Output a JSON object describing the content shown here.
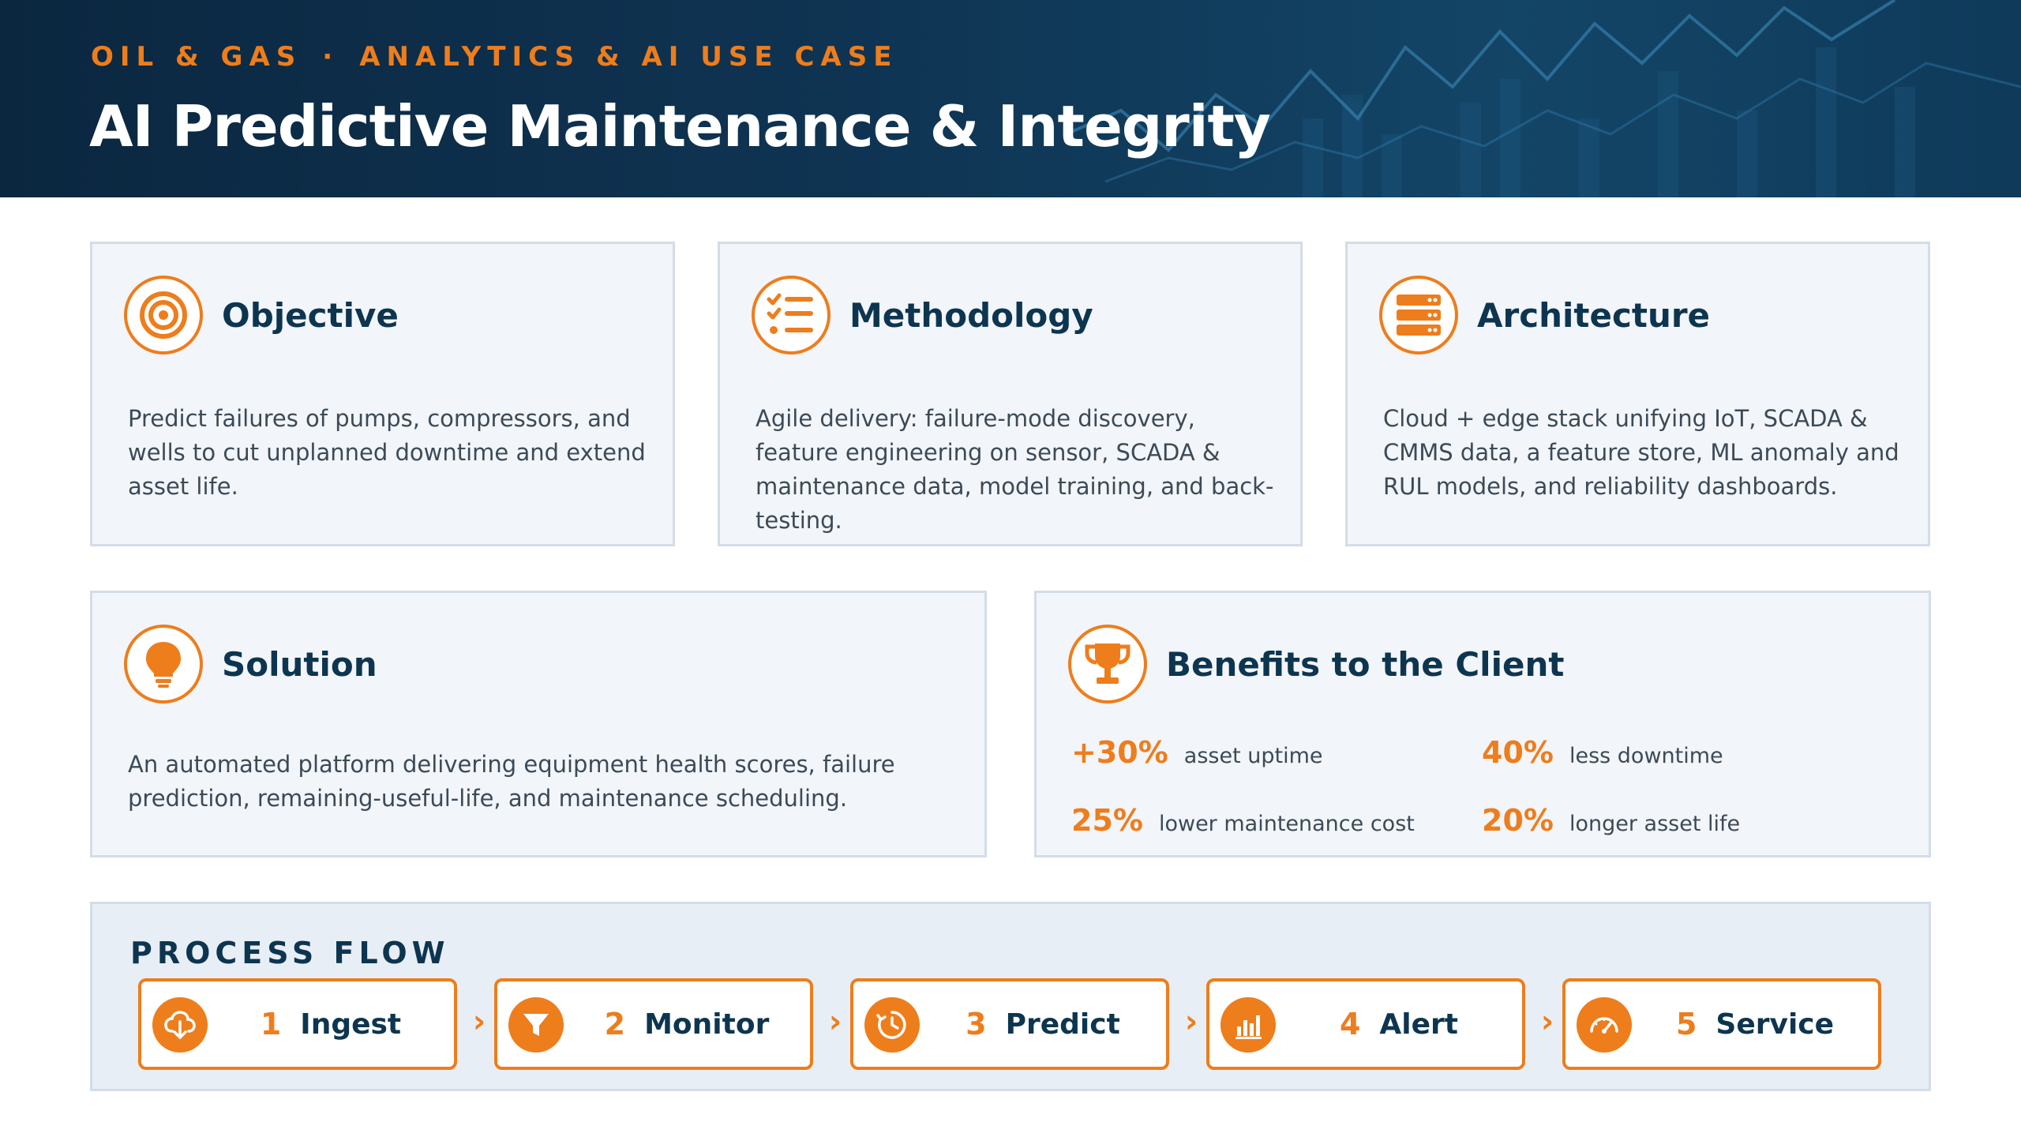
{
  "header": {
    "eyebrow_left": "OIL & GAS",
    "eyebrow_sep": "·",
    "eyebrow_right": "ANALYTICS & AI USE CASE",
    "title": "AI Predictive Maintenance & Integrity"
  },
  "cards": {
    "objective": {
      "icon": "target-icon",
      "title": "Objective",
      "text": "Predict failures of pumps, compressors, and wells to cut unplanned downtime and extend asset life."
    },
    "methodology": {
      "icon": "checklist-icon",
      "title": "Methodology",
      "text": "Agile delivery: failure-mode discovery, feature engineering on sensor, SCADA & maintenance data, model training, and back-testing."
    },
    "architecture": {
      "icon": "server-stack-icon",
      "title": "Architecture",
      "text": "Cloud + edge stack unifying IoT, SCADA & CMMS data, a feature store, ML anomaly and RUL models, and reliability dashboards."
    },
    "solution": {
      "icon": "lightbulb-icon",
      "title": "Solution",
      "text": "An automated platform delivering equipment health scores, failure prediction, remaining-useful-life, and maintenance scheduling."
    },
    "benefits": {
      "icon": "trophy-icon",
      "title": "Benefits to the Client",
      "items": [
        {
          "value": "+30%",
          "label": "asset uptime"
        },
        {
          "value": "40%",
          "label": "less downtime"
        },
        {
          "value": "25%",
          "label": "lower maintenance cost"
        },
        {
          "value": "20%",
          "label": "longer asset life"
        }
      ]
    }
  },
  "process": {
    "title": "PROCESS FLOW",
    "arrow": "›",
    "steps": [
      {
        "num": "1",
        "label": "Ingest",
        "icon": "cloud-download-icon"
      },
      {
        "num": "2",
        "label": "Monitor",
        "icon": "filter-icon"
      },
      {
        "num": "3",
        "label": "Predict",
        "icon": "clock-icon"
      },
      {
        "num": "4",
        "label": "Alert",
        "icon": "bar-chart-icon"
      },
      {
        "num": "5",
        "label": "Service",
        "icon": "gauge-icon"
      }
    ]
  },
  "colors": {
    "accent": "#ee7d1c",
    "navy": "#0d3550",
    "card_bg": "#f2f5f9"
  }
}
